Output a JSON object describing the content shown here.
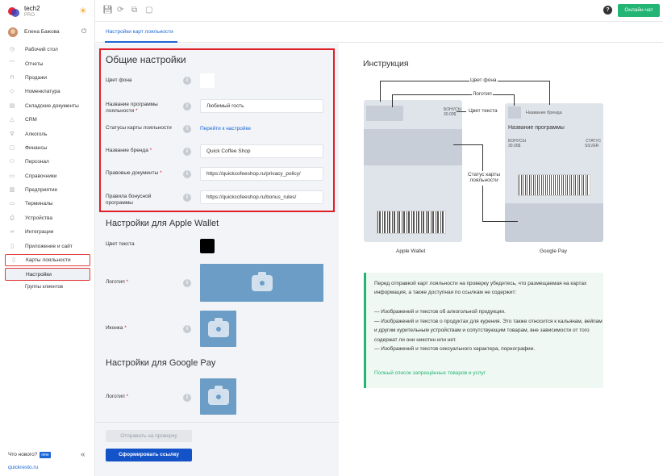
{
  "app": {
    "name": "tech2",
    "plan": "PRO"
  },
  "user": {
    "name": "Елена Бажова"
  },
  "nav": [
    {
      "label": "Рабочий стол",
      "icon": "dashboard-icon",
      "glyph": "◷"
    },
    {
      "label": "Отчеты",
      "icon": "chart-icon",
      "glyph": "⌒"
    },
    {
      "label": "Продажи",
      "icon": "cart-icon",
      "glyph": "⊓"
    },
    {
      "label": "Номенклатура",
      "icon": "tag-icon",
      "glyph": "◇"
    },
    {
      "label": "Складские документы",
      "icon": "document-icon",
      "glyph": "▤"
    },
    {
      "label": "CRM",
      "icon": "crm-icon",
      "glyph": "△"
    },
    {
      "label": "Алкоголь",
      "icon": "glass-icon",
      "glyph": "∇"
    },
    {
      "label": "Финансы",
      "icon": "finance-icon",
      "glyph": "▢"
    },
    {
      "label": "Персонал",
      "icon": "people-icon",
      "glyph": "⚇"
    },
    {
      "label": "Справочники",
      "icon": "book-icon",
      "glyph": "▭"
    },
    {
      "label": "Предприятие",
      "icon": "building-icon",
      "glyph": "▥"
    },
    {
      "label": "Терминалы",
      "icon": "terminal-icon",
      "glyph": "▭"
    },
    {
      "label": "Устройства",
      "icon": "printer-icon",
      "glyph": "⎙"
    },
    {
      "label": "Интеграции",
      "icon": "integration-icon",
      "glyph": "∞"
    },
    {
      "label": "Приложение и сайт",
      "icon": "app-icon",
      "glyph": "▯"
    }
  ],
  "nav_active": {
    "label": "Карты лояльности",
    "sub_selected": "Настройки",
    "sub_other": "Группы клиентов"
  },
  "footer": {
    "whats_new": "Что нового?",
    "badge": "new",
    "site": "quickresto.ru"
  },
  "topbar": {
    "chat": "Онлайн-чат",
    "help": "?"
  },
  "tab": "Настройки карт лояльности",
  "general": {
    "title": "Общие настройки",
    "bg_color_label": "Цвет фона",
    "bg_color": "#ffffff",
    "program_name_label": "Название программы лояльности",
    "program_name_value": "Любимый гость",
    "statuses_label": "Статусы карты лояльности",
    "statuses_link": "Перейти к настройке",
    "brand_label": "Название бренда",
    "brand_value": "Quick Coffee Shop",
    "legal_label": "Правовые документы",
    "legal_value": "https://quickcofeeshop.ru/privacy_policy/",
    "bonus_label": "Правила бонусной программы",
    "bonus_value": "https://quickcofeeshop.ru/bonus_rules/"
  },
  "apple": {
    "title": "Настройки для Apple Wallet",
    "text_color_label": "Цвет текста",
    "text_color": "#000000",
    "logo_label": "Логотип",
    "icon_label": "Иконка"
  },
  "google": {
    "title": "Настройки для Google Pay",
    "logo_label": "Логотип"
  },
  "buttons": {
    "send": "Отправить на проверку",
    "generate": "Сформировать ссылку"
  },
  "instruction": {
    "title": "Инструкция",
    "annot_bg": "Цвет фона",
    "annot_logo": "Логотип",
    "annot_text": "Цвет текста",
    "annot_status": "Статус карты лояльности",
    "apple_label": "Apple Wallet",
    "google_label": "Google Pay",
    "apple_small_top": "БОНУСЫ",
    "apple_small_val": "30.00$",
    "g_brand": "Название бренда",
    "g_program": "Название программы",
    "g_bonus_k": "БОНУСЫ",
    "g_bonus_v": "30.00$",
    "g_status_k": "СТАТУС",
    "g_status_v": "SILVER"
  },
  "notice": {
    "intro": "Перед отправкой карт лояльности на проверку убедитесь, что размещаемая на картах информация, а также доступная по ссылкам не содержит:",
    "item1": "— Изображений и текстов об алкогольной продукции.",
    "item2": "— Изображений и текстов о продуктах для курения. Это также относится к кальянам, вейпам и другим курительным устройствам и сопутствующим товарам, вне зависимости от того содержат ли они никотин или нет.",
    "item3": "— Изображений и текстов сексуального характера, порнографии.",
    "link": "Полный список запрещённых товаров и услуг"
  }
}
